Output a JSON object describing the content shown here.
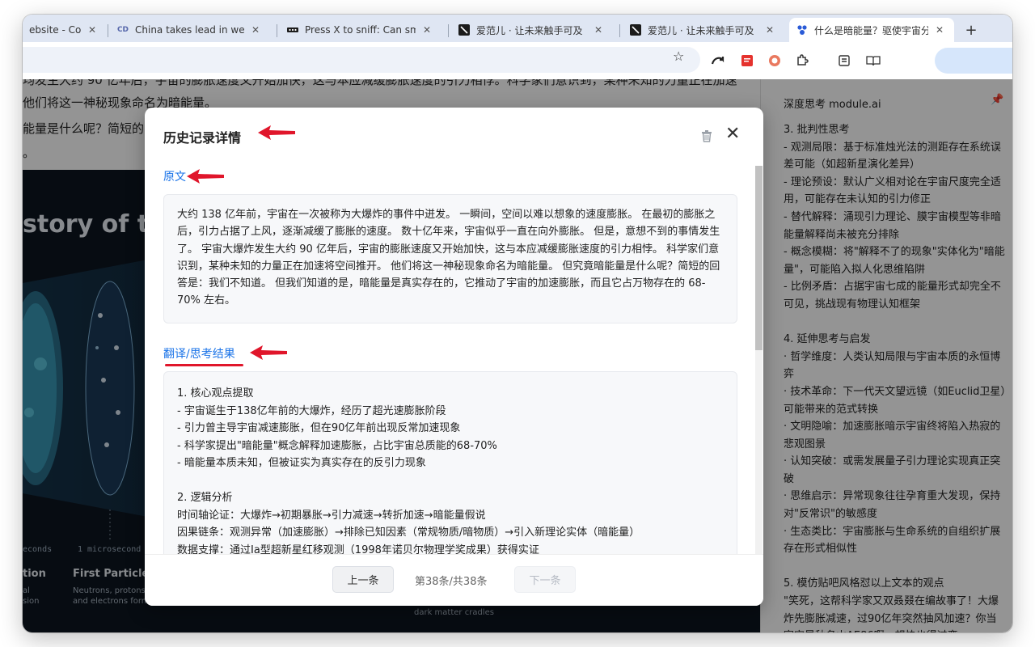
{
  "tabs": [
    {
      "title": "ebsite - Con",
      "favicon": "page-icon"
    },
    {
      "title": "China takes lead in wetland",
      "favicon": "cd-logo-icon",
      "favicon_text": "CD"
    },
    {
      "title": "Press X to sniff: Can smell",
      "favicon": "dots-icon"
    },
    {
      "title": "爱范儿 · 让未来触手可及",
      "favicon": "ifanr-logo-icon"
    },
    {
      "title": "爱范儿 · 让未来触手可及",
      "favicon": "ifanr-logo-icon"
    },
    {
      "title": "什么是暗能量？驱使宇宙分",
      "favicon": "paw-icon",
      "active": true
    }
  ],
  "article": {
    "line1": "均发生大约 90 亿年后，宇宙的膨胀速度又开始加快，这与本应减缓膨胀速度的引力相悖。科学家们意识到，某种未知的力量正在加速",
    "line2": "他们将这一神秘现象命名为暗能量。",
    "line3": "能量是什么呢？简短的回",
    "line4": "。",
    "hero_title": "story of the",
    "hero_label_seconds": "econds",
    "hero_label_micro": "1 microsecond",
    "caption1_title": "tion",
    "caption1_text": "al\nsion",
    "caption2_title": "First Particles",
    "caption2_text": "Neutrons, protons,\nand electrons form",
    "caption3_text": "dark matter cradles"
  },
  "side_panel": {
    "title": "深度思考 module.ai",
    "sections": [
      {
        "heading": "3. 批判性思考",
        "lines": [
          "- 观测局限：基于标准烛光法的测距存在系统误差可能（如超新星演化差异）",
          "- 理论预设：默认广义相对论在宇宙尺度完全适用，可能存在未认知的引力修正",
          "- 替代解释：涌现引力理论、膜宇宙模型等非暗能量解释尚未被充分排除",
          "- 概念模糊：将\"解释不了的现象\"实体化为\"暗能量\"，可能陷入拟人化思维陷阱",
          "- 比例矛盾：占据宇宙七成的能量形式却完全不可见，挑战现有物理认知框架"
        ]
      },
      {
        "heading": "4. 延伸思考与启发",
        "lines": [
          "· 哲学维度：人类认知局限与宇宙本质的永恒博弈",
          "· 技术革命：下一代天文望远镜（如Euclid卫星）可能带来的范式转换",
          "· 文明隐喻：加速膨胀暗示宇宙终将陷入热寂的悲观图景",
          "· 认知突破：或需发展量子引力理论实现真正突破",
          "· 思维启示：异常现象往往孕育重大发现，保持对\"反常识\"的敏感度",
          "· 生态类比：宇宙膨胀与生命系统的自组织扩展存在形式相似性"
        ]
      },
      {
        "heading": "5. 模仿贴吧风格怼以上文本的观点",
        "lines": [
          "\"笑死，这帮科学家又双叒叕在编故事了！大爆炸先膨胀减速，过90亿年突然抽风加速？你当宇宙是秋名山AE86啊，想快也得过弯"
        ]
      }
    ]
  },
  "modal": {
    "title": "历史记录详情",
    "original_label": "原文",
    "original_text": "大约 138 亿年前，宇宙在一次被称为大爆炸的事件中迸发。 一瞬间，空间以难以想象的速度膨胀。 在最初的膨胀之后，引力占据了上风，逐渐减缓了膨胀的速度。 数十亿年来，宇宙似乎一直在向外膨胀。 但是，意想不到的事情发生了。 宇宙大爆炸发生大约 90 亿年后，宇宙的膨胀速度又开始加快，这与本应减缓膨胀速度的引力相悖。 科学家们意识到，某种未知的力量正在加速将空间推开。 他们将这一神秘现象命名为暗能量。 但究竟暗能量是什么呢？简短的回答是：我们不知道。 但我们知道的是，暗能量是真实存在的，它推动了宇宙的加速膨胀，而且它占万物存在的 68-70% 左右。",
    "result_label": "翻译/思考结果",
    "result_lines": [
      "1. 核心观点提取",
      "- 宇宙诞生于138亿年前的大爆炸，经历了超光速膨胀阶段",
      "- 引力曾主导宇宙减速膨胀，但在90亿年前出现反常加速现象",
      "- 科学家提出\"暗能量\"概念解释加速膨胀，占比宇宙总质能的68-70%",
      "- 暗能量本质未知，但被证实为真实存在的反引力现象",
      "",
      "2. 逻辑分析",
      "时间轴论证：大爆炸→初期暴胀→引力减速→转折加速→暗能量假说",
      "因果链条：观测异常（加速膨胀）→排除已知因素（常规物质/暗物质）→引入新理论实体（暗能量）",
      "数据支撑：通过Ia型超新星红移观测（1998年诺贝尔物理学奖成果）获得实证"
    ],
    "prev_label": "上一条",
    "pager_text": "第38条/共38条",
    "next_label": "下一条"
  },
  "colors": {
    "accent": "#1a73e8",
    "annotation": "#e0162b",
    "tabbar": "#dfe6f3"
  }
}
